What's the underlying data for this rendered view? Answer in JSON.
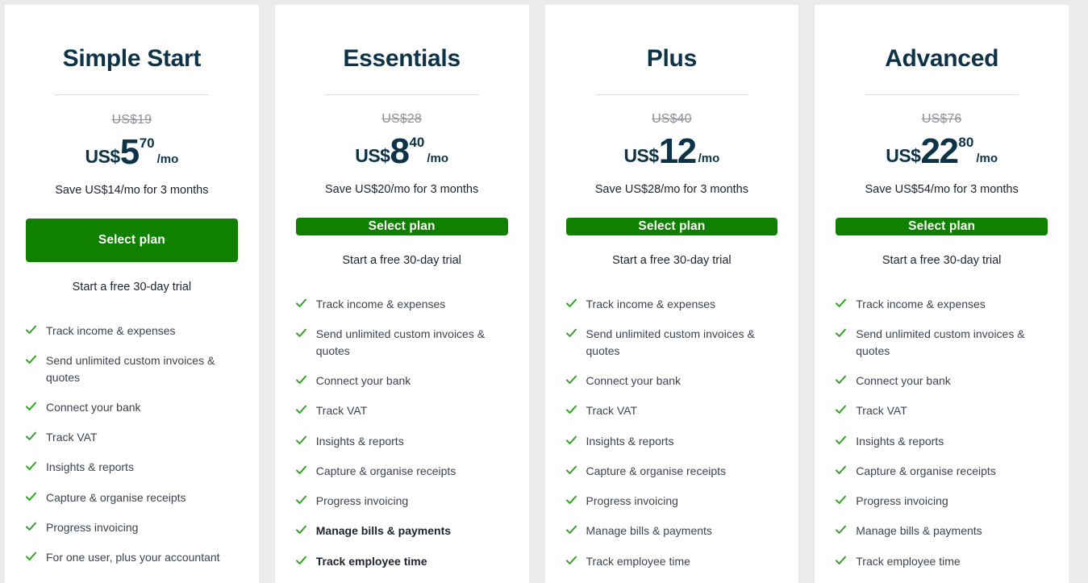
{
  "theme": {
    "page_background": "#ebebeb",
    "card_background": "#ffffff",
    "title_color": "#0d3349",
    "button_color": "#108000",
    "check_color": "#2ca01c",
    "old_price_color": "#8d9096",
    "feature_text_color": "#3c4350"
  },
  "plans": [
    {
      "name": "Simple Start",
      "old_price": "US$19",
      "currency_symbol": "US$",
      "price_integer": "5",
      "price_cents": "70",
      "price_period": "/mo",
      "save_note": "Save US$14/mo for 3 months",
      "cta_label": "Select plan",
      "trial_note": "Start a free 30-day trial",
      "features": [
        {
          "label": "Track income & expenses",
          "highlighted": false
        },
        {
          "label": "Send unlimited custom invoices & quotes",
          "highlighted": false
        },
        {
          "label": "Connect your bank",
          "highlighted": false
        },
        {
          "label": "Track VAT",
          "highlighted": false
        },
        {
          "label": "Insights & reports",
          "highlighted": false
        },
        {
          "label": "Capture & organise receipts",
          "highlighted": false
        },
        {
          "label": "Progress invoicing",
          "highlighted": false
        },
        {
          "label": "For one user, plus your accountant",
          "highlighted": false
        }
      ]
    },
    {
      "name": "Essentials",
      "old_price": "US$28",
      "currency_symbol": "US$",
      "price_integer": "8",
      "price_cents": "40",
      "price_period": "/mo",
      "save_note": "Save US$20/mo for 3 months",
      "cta_label": "Select plan",
      "trial_note": "Start a free 30-day trial",
      "features": [
        {
          "label": "Track income & expenses",
          "highlighted": false
        },
        {
          "label": "Send unlimited custom invoices & quotes",
          "highlighted": false
        },
        {
          "label": "Connect your bank",
          "highlighted": false
        },
        {
          "label": "Track VAT",
          "highlighted": false
        },
        {
          "label": "Insights & reports",
          "highlighted": false
        },
        {
          "label": "Capture & organise receipts",
          "highlighted": false
        },
        {
          "label": "Progress invoicing",
          "highlighted": false
        },
        {
          "label": "Manage bills & payments",
          "highlighted": true
        },
        {
          "label": "Track employee time",
          "highlighted": true
        }
      ]
    },
    {
      "name": "Plus",
      "old_price": "US$40",
      "currency_symbol": "US$",
      "price_integer": "12",
      "price_cents": "",
      "price_period": "/mo",
      "save_note": "Save US$28/mo for 3 months",
      "cta_label": "Select plan",
      "trial_note": "Start a free 30-day trial",
      "features": [
        {
          "label": "Track income & expenses",
          "highlighted": false
        },
        {
          "label": "Send unlimited custom invoices & quotes",
          "highlighted": false
        },
        {
          "label": "Connect your bank",
          "highlighted": false
        },
        {
          "label": "Track VAT",
          "highlighted": false
        },
        {
          "label": "Insights & reports",
          "highlighted": false
        },
        {
          "label": "Capture & organise receipts",
          "highlighted": false
        },
        {
          "label": "Progress invoicing",
          "highlighted": false
        },
        {
          "label": "Manage bills & payments",
          "highlighted": false
        },
        {
          "label": "Track employee time",
          "highlighted": false
        }
      ]
    },
    {
      "name": "Advanced",
      "old_price": "US$76",
      "currency_symbol": "US$",
      "price_integer": "22",
      "price_cents": "80",
      "price_period": "/mo",
      "save_note": "Save US$54/mo for 3 months",
      "cta_label": "Select plan",
      "trial_note": "Start a free 30-day trial",
      "features": [
        {
          "label": "Track income & expenses",
          "highlighted": false
        },
        {
          "label": "Send unlimited custom invoices & quotes",
          "highlighted": false
        },
        {
          "label": "Connect your bank",
          "highlighted": false
        },
        {
          "label": "Track VAT",
          "highlighted": false
        },
        {
          "label": "Insights & reports",
          "highlighted": false
        },
        {
          "label": "Capture & organise receipts",
          "highlighted": false
        },
        {
          "label": "Progress invoicing",
          "highlighted": false
        },
        {
          "label": "Manage bills & payments",
          "highlighted": false
        },
        {
          "label": "Track employee time",
          "highlighted": false
        }
      ]
    }
  ]
}
